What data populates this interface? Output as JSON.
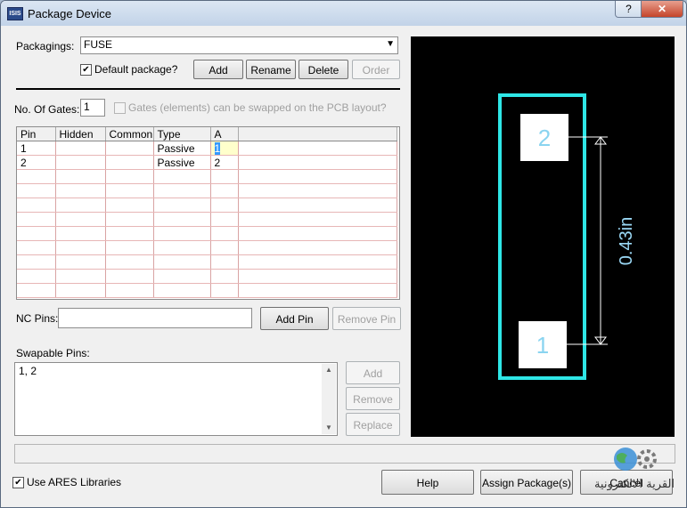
{
  "window": {
    "title": "Package Device",
    "app_icon": "ISIS",
    "help_glyph": "?",
    "close_glyph": "✕"
  },
  "packaging": {
    "label": "Packagings:",
    "value": "FUSE",
    "default_label": "Default package?",
    "default_checked": true,
    "buttons": {
      "add": "Add",
      "rename": "Rename",
      "delete": "Delete",
      "order": "Order"
    }
  },
  "gates": {
    "label": "No. Of Gates:",
    "value": "1",
    "swap_label": "Gates (elements) can be swapped on the PCB layout?"
  },
  "pin_grid": {
    "columns": [
      "Pin",
      "Hidden",
      "Common",
      "Type",
      "A"
    ],
    "rows": [
      [
        "1",
        "",
        "",
        "Passive",
        "1"
      ],
      [
        "2",
        "",
        "",
        "Passive",
        "2"
      ]
    ]
  },
  "nc_pins": {
    "label": "NC Pins:",
    "value": "",
    "add_button": "Add Pin",
    "remove_button": "Remove Pin"
  },
  "swapable": {
    "label": "Swapable Pins:",
    "value": "1, 2",
    "buttons": {
      "add": "Add",
      "remove": "Remove",
      "replace": "Replace"
    }
  },
  "footer": {
    "use_ares_label": "Use ARES Libraries",
    "use_ares_checked": true,
    "help": "Help",
    "assign": "Assign Package(s)",
    "cancel": "Cancel"
  },
  "preview": {
    "pad_top": "2",
    "pad_bottom": "1",
    "dimension": "0.43in",
    "outline_color": "#2ee6e6",
    "pad_fill": "#ffffff",
    "pad_label_color": "#8ad4f0",
    "dimension_color": "#9ad8f5"
  },
  "watermark": {
    "text": "القرية الالكترونية"
  }
}
